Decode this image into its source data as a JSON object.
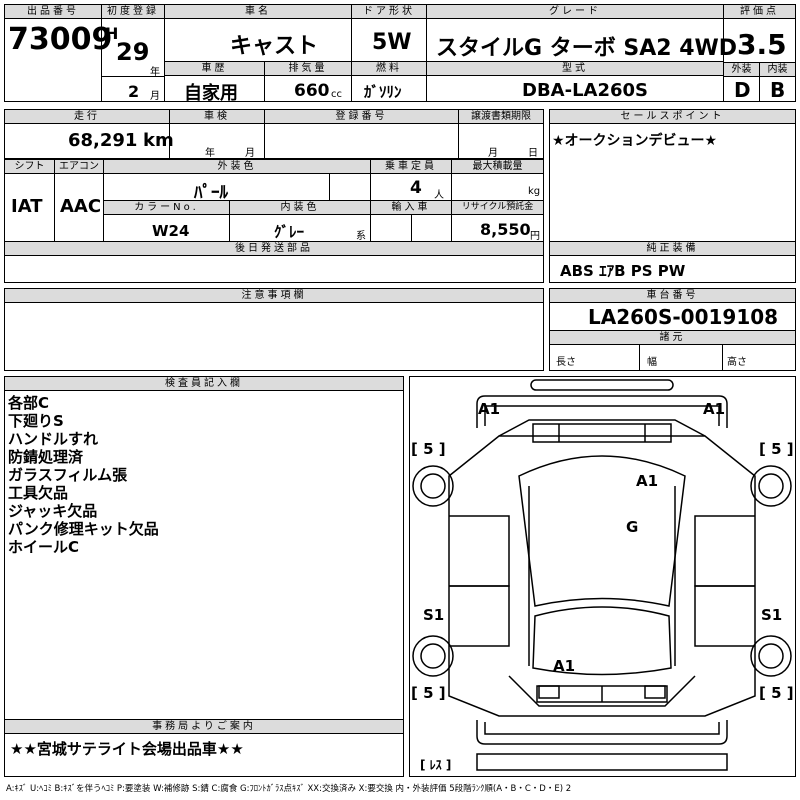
{
  "header": {
    "lot_label": "出品番号",
    "lot_no": "73009",
    "reg_label": "初度登録",
    "era": "H",
    "year": "29",
    "year_unit": "年",
    "month": "2",
    "month_unit": "月",
    "name_label": "車名",
    "name": "キャスト",
    "door_label": "ドア形状",
    "door": "5W",
    "grade_label": "グレード",
    "grade": "スタイルG ターボ SA2 4WD",
    "score_label": "評価点",
    "score": "3.5",
    "history_label": "車歴",
    "history": "自家用",
    "disp_label": "排気量",
    "disp": "660",
    "disp_unit": "cc",
    "fuel_label": "燃料",
    "fuel": "ｶﾞｿﾘﾝ",
    "model_label": "型式",
    "model": "DBA-LA260S",
    "ext_label": "外装",
    "ext": "D",
    "int_label": "内装",
    "int": "B"
  },
  "row2": {
    "mileage_label": "走行",
    "mileage": "68,291",
    "mileage_unit": "km",
    "shaken_label": "車検",
    "shaken_year_unit": "年",
    "shaken_month_unit": "月",
    "regno_label": "登録番号",
    "transfer_label": "譲渡書類期限",
    "transfer_month_unit": "月",
    "transfer_day_unit": "日",
    "sales_label": "セールスポイント",
    "sales_text": "★オークションデビュー★"
  },
  "row3": {
    "shift_label": "シフト",
    "shift": "IAT",
    "ac_label": "エアコン",
    "ac": "AAC",
    "color_label": "外装色",
    "color": "ﾊﾟｰﾙ",
    "seats_label": "乗車定員",
    "seats": "4",
    "seats_unit": "人",
    "load_label": "最大積載量",
    "load_unit": "kg",
    "colorno_label": "カラーNo.",
    "colorno": "W24",
    "intcolor_label": "内装色",
    "intcolor": "ｸﾞﾚｰ",
    "intcolor_unit": "系",
    "import_label": "輸入車",
    "recycle_label": "リサイクル預託金",
    "recycle": "8,550",
    "recycle_unit": "円"
  },
  "later_label": "後日発送部品",
  "equip_label": "純正装備",
  "equip": "ABS ｴｱB PS PW",
  "notes_label": "注意事項欄",
  "chassis_label": "車台番号",
  "chassis": "LA260S-0019108",
  "spec_label": "諸元",
  "length_label": "長さ",
  "width_label": "幅",
  "height_label": "高さ",
  "inspector_label": "検査員記入欄",
  "inspector_items": [
    "各部C",
    "下廻りS",
    "ハンドルすれ",
    "防錆処理済",
    "ガラスフィルム張",
    "工具欠品",
    "ジャッキ欠品",
    "パンク修理キット欠品",
    "ホイールC"
  ],
  "office_label": "事務局よりご案内",
  "office_text": "★★宮城サテライト会場出品車★★",
  "diagram": {
    "marks": [
      {
        "id": "front-left",
        "text": "A1"
      },
      {
        "id": "front-right",
        "text": "A1"
      },
      {
        "id": "roof",
        "text": "A1"
      },
      {
        "id": "glass",
        "text": "G"
      },
      {
        "id": "side-left",
        "text": "S1"
      },
      {
        "id": "side-right",
        "text": "S1"
      },
      {
        "id": "rear",
        "text": "A1"
      },
      {
        "id": "tire-fl",
        "text": "[ 5 ]"
      },
      {
        "id": "tire-fr",
        "text": "[ 5 ]"
      },
      {
        "id": "tire-rl",
        "text": "[ 5 ]"
      },
      {
        "id": "tire-rr",
        "text": "[ 5 ]"
      },
      {
        "id": "spare",
        "text": "[ ﾚｽ ]"
      }
    ]
  },
  "legend": "A:ｷｽﾞ U:ﾍｺﾐ B:ｷｽﾞを伴うﾍｺﾐ P:要塗装 W:補修跡 S:錆 C:腐食 G:ﾌﾛﾝﾄｶﾞﾗｽ点ｷｽﾞ XX:交換済み X:要交換 内・外装評価 5段階ﾗﾝｸ順(A・B・C・D・E) 2"
}
